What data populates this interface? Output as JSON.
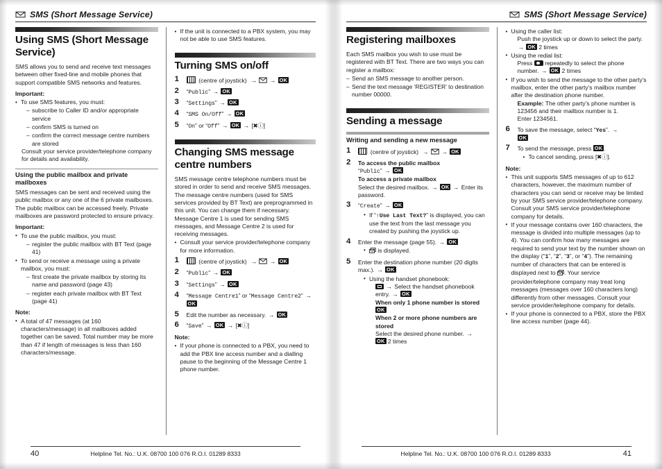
{
  "document": {
    "running_head": "SMS (Short Message Service)",
    "footer_helpline": "Helpline Tel. No.: U.K. 08700 100 076  R.O.I. 01289 8333"
  },
  "left_page": {
    "page_number": "40",
    "col1": {
      "h1": "Using SMS (Short Message Service)",
      "intro": "SMS allows you to send and receive text messages between other fixed-line and mobile phones that support compatible SMS networks and features.",
      "important_label": "Important:",
      "important_bullet": "To use SMS features, you must:",
      "important_dashes": [
        "subscribe to Caller ID and/or appropriate service",
        "confirm SMS is turned on",
        "confirm the correct message centre numbers are stored"
      ],
      "consult": "Consult your service provider/telephone company for details and availability.",
      "sub_h2": "Using the public mailbox and private mailboxes",
      "sub_body": "SMS messages can be sent and received using the public mailbox or any one of the 6 private mailboxes. The public mailbox can be accessed freely. Private mailboxes are password protected to ensure privacy.",
      "important2_label": "Important:",
      "important2_bullets": [
        {
          "text": "To use the public mailbox, you must:",
          "dashes": [
            "register the public mailbox with BT Text (page 41)"
          ]
        },
        {
          "text": "To send or receive a message using a private mailbox, you must:",
          "dashes": [
            "first create the private mailbox by storing its name and password (page 43)",
            "register each private mailbox with BT Text (page 41)"
          ]
        }
      ],
      "note_label": "Note:",
      "note_bullets": [
        "A total of 47 messages (at 160 characters/message) in all mailboxes added together can be saved. Total number may be more than 47 if length of messages is less than 160 characters/message."
      ]
    },
    "col2": {
      "lead_bullet": "If the unit is connected to a PBX system, you may not be able to use SMS features.",
      "h1_a": "Turning SMS on/off",
      "steps_a": [
        {
          "parts": [
            {
              "t": "icon",
              "v": "joystick-icon"
            },
            {
              "t": "text",
              "v": " (centre of joystick) "
            },
            {
              "t": "arrow",
              "v": "→"
            },
            {
              "t": "icon",
              "v": "envelope-icon"
            },
            {
              "t": "arrow",
              "v": "→"
            },
            {
              "t": "key",
              "v": "OK"
            }
          ]
        },
        {
          "parts": [
            {
              "t": "quote",
              "v": "Public"
            },
            {
              "t": "arrow",
              "v": "→"
            },
            {
              "t": "key",
              "v": "OK"
            }
          ]
        },
        {
          "parts": [
            {
              "t": "quote",
              "v": "Settings"
            },
            {
              "t": "arrow",
              "v": "→"
            },
            {
              "t": "key",
              "v": "OK"
            }
          ]
        },
        {
          "parts": [
            {
              "t": "quote",
              "v": "SMS On/Off"
            },
            {
              "t": "arrow",
              "v": "→"
            },
            {
              "t": "key",
              "v": "OK"
            }
          ]
        },
        {
          "parts": [
            {
              "t": "quote",
              "v": "On"
            },
            {
              "t": "text",
              "v": " or "
            },
            {
              "t": "quote",
              "v": "Off"
            },
            {
              "t": "arrow",
              "v": "→"
            },
            {
              "t": "key",
              "v": "OK"
            },
            {
              "t": "arrow",
              "v": "→"
            },
            {
              "t": "offkey",
              "v": "[✖ⓘ]"
            }
          ]
        }
      ],
      "h1_b": "Changing SMS message centre numbers",
      "body_b1": "SMS message centre telephone numbers must be stored in order to send and receive SMS messages.",
      "body_b2": "The message centre numbers (used for SMS services provided by BT Text) are preprogrammed in this unit. You can change them if necessary.",
      "body_b3": "Message Centre 1 is used for sending SMS messages, and Message Centre 2 is used for receiving messages.",
      "bullet_b": "Consult your service provider/telephone company for more information.",
      "steps_b": [
        {
          "parts": [
            {
              "t": "icon",
              "v": "joystick-icon"
            },
            {
              "t": "text",
              "v": " (centre of joystick) "
            },
            {
              "t": "arrow",
              "v": "→"
            },
            {
              "t": "icon",
              "v": "envelope-icon"
            },
            {
              "t": "arrow",
              "v": "→"
            },
            {
              "t": "key",
              "v": "OK"
            }
          ]
        },
        {
          "parts": [
            {
              "t": "quote",
              "v": "Public"
            },
            {
              "t": "arrow",
              "v": "→"
            },
            {
              "t": "key",
              "v": "OK"
            }
          ]
        },
        {
          "parts": [
            {
              "t": "quote",
              "v": "Settings"
            },
            {
              "t": "arrow",
              "v": "→"
            },
            {
              "t": "key",
              "v": "OK"
            }
          ]
        },
        {
          "parts": [
            {
              "t": "quote",
              "v": "Message Centre1"
            },
            {
              "t": "text",
              "v": " or "
            },
            {
              "t": "quote",
              "v": "Message Centre2"
            },
            {
              "t": "arrow",
              "v": "→"
            },
            {
              "t": "key",
              "v": "OK"
            }
          ]
        },
        {
          "parts": [
            {
              "t": "text",
              "v": "Edit the number as necessary. "
            },
            {
              "t": "arrow",
              "v": "→"
            },
            {
              "t": "key",
              "v": "OK"
            }
          ]
        },
        {
          "parts": [
            {
              "t": "quote",
              "v": "Save"
            },
            {
              "t": "arrow",
              "v": "→"
            },
            {
              "t": "key",
              "v": "OK"
            },
            {
              "t": "arrow",
              "v": "→"
            },
            {
              "t": "offkey",
              "v": "[✖ⓘ]"
            }
          ]
        }
      ],
      "note_label": "Note:",
      "note_bullets": [
        "If your phone is connected to a PBX, you need to add the PBX line access number and a dialling pause to the beginning of the Message Centre 1 phone number."
      ]
    }
  },
  "right_page": {
    "page_number": "41",
    "col1": {
      "h1_a": "Registering mailboxes",
      "body_a": "Each SMS mailbox you wish to use must be registered with BT Text. There are two ways you can register a mailbox:",
      "dashes_a": [
        "Send an SMS message to another person.",
        "Send the text message 'REGISTER' to destination number 00000."
      ],
      "h1_b": "Sending a message",
      "sub_h2": "Writing and sending a new message",
      "steps": [
        {
          "parts": [
            {
              "t": "icon",
              "v": "joystick-icon"
            },
            {
              "t": "text",
              "v": " (centre of joystick) "
            },
            {
              "t": "arrow",
              "v": "→"
            },
            {
              "t": "icon",
              "v": "envelope-icon"
            },
            {
              "t": "arrow",
              "v": "→"
            },
            {
              "t": "key",
              "v": "OK"
            }
          ]
        },
        {
          "bold_line_1": "To access the public mailbox",
          "parts": [
            {
              "t": "quote",
              "v": "Public"
            },
            {
              "t": "arrow",
              "v": "→"
            },
            {
              "t": "key",
              "v": "OK"
            }
          ],
          "bold_line_2": "To access a private mailbox",
          "parts2": [
            {
              "t": "text",
              "v": "Select the desired mailbox. "
            },
            {
              "t": "arrow",
              "v": "→"
            },
            {
              "t": "key",
              "v": "OK"
            },
            {
              "t": "arrow",
              "v": "→"
            },
            {
              "t": "text",
              "v": " Enter its password."
            }
          ]
        },
        {
          "parts": [
            {
              "t": "quote",
              "v": "Create"
            },
            {
              "t": "arrow",
              "v": "→"
            },
            {
              "t": "key",
              "v": "OK"
            }
          ],
          "bullet_pre": "If ",
          "bullet_quote": "↑Use Last Text?",
          "bullet_post": " is displayed, you can use the text from the last message you created by pushing the joystick up."
        },
        {
          "parts": [
            {
              "t": "text",
              "v": "Enter the message (page 55). "
            },
            {
              "t": "arrow",
              "v": "→"
            },
            {
              "t": "key",
              "v": "OK"
            }
          ],
          "bullet_icon": "message-count-icon",
          "bullet_post": " is displayed."
        },
        {
          "parts": [
            {
              "t": "text",
              "v": "Enter the destination phone number (20 digits max.). "
            },
            {
              "t": "arrow",
              "v": "→"
            },
            {
              "t": "key",
              "v": "OK"
            }
          ],
          "bullet_label": "Using the handset phonebook:",
          "sub_parts": [
            {
              "t": "icon",
              "v": "phonebook-icon"
            },
            {
              "t": "arrow",
              "v": "→"
            },
            {
              "t": "text",
              "v": " Select the handset phonebook entry. "
            },
            {
              "t": "arrow",
              "v": "→"
            },
            {
              "t": "key",
              "v": "OK"
            }
          ],
          "bold_a": "When only 1 phone number is stored",
          "key_a": "OK",
          "bold_b": "When 2 or more phone numbers are stored",
          "tail": "Select the desired phone number. ",
          "tail_key": "OK",
          "tail_times": " 2 times"
        }
      ]
    },
    "col2": {
      "lead_bullets": [
        {
          "label": "Using the caller list:",
          "line_pre": "Push the joystick up or down to select the party. ",
          "arrow": "→",
          "key": "OK",
          "line_post": " 2 times"
        },
        {
          "label": "Using the redial list:",
          "line_pre": "Press ",
          "icon": "redial-icon",
          "line_mid": " repeatedly to select the phone number. ",
          "arrow": "→",
          "key": "OK",
          "line_post": " 2 times"
        }
      ],
      "mailbox_bullet": "If you wish to send the message to the other party's mailbox, enter the other party's mailbox number after the destination phone number.",
      "example_label": "Example:",
      "example_text": " The other party's phone number is 123456 and their mailbox number is 1.",
      "example_enter": "Enter 1234561.",
      "steps": [
        {
          "num": "6",
          "pre": "To save the message, select ",
          "quote": "Yes",
          "mid": ". ",
          "arrow": "→",
          "key": "OK"
        },
        {
          "num": "7",
          "pre": "To send the message, press ",
          "key": "OK",
          "post": ".",
          "bullet": "To cancel sending, press ",
          "bullet_key": "[✖ⓘ]",
          "bullet_post": "."
        }
      ],
      "note_label": "Note:",
      "note_bullets": [
        "This unit supports SMS messages of up to 612 characters, however, the maximum number of characters you can send or receive may be limited by your SMS service provider/telephone company. Consult your SMS service provider/telephone company for details.",
        "If your phone is connected to a PBX, store the PBX line access number (page 44)."
      ],
      "note_long_pre": "If your message contains over 160 characters, the message is divided into multiple messages (up to 4). You can confirm how many messages are required to send your text by the number shown on the display (",
      "note_q1": "1",
      "note_s1": ", ",
      "note_q2": "2",
      "note_s2": ", ",
      "note_q3": "3",
      "note_s3": ", or ",
      "note_q4": "4",
      "note_long_mid": "). The remaining number of characters that can be entered is displayed next to ",
      "note_long_post": ". Your service provider/telephone company may treat long messages (messages over 160 characters long) differently from other messages. Consult your service provider/telephone company for details."
    }
  },
  "icons": {
    "envelope": "envelope-icon",
    "joystick": "joystick-icon",
    "ok_key": "ok-key",
    "power_off_key": "off-hook-key",
    "phonebook": "phonebook-icon",
    "redial": "redial-icon",
    "message_count": "message-count-icon"
  }
}
